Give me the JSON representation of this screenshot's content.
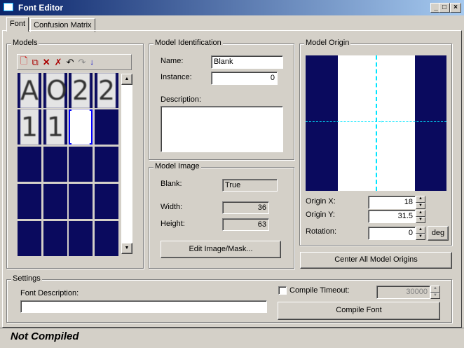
{
  "window": {
    "title": "Font Editor",
    "buttons": [
      "_",
      "□",
      "×"
    ]
  },
  "tabs": [
    {
      "label": "Font",
      "active": true
    },
    {
      "label": "Confusion Matrix",
      "active": false
    }
  ],
  "models": {
    "title": "Models",
    "toolbar": [
      "new-model-icon",
      "copy-model-icon",
      "delete-icon",
      "delete-all-icon",
      "undo-icon",
      "redo-icon",
      "sort-icon"
    ],
    "cells": [
      "A",
      "O",
      "2",
      "2",
      "1",
      "1",
      "",
      "",
      "",
      "",
      "",
      "",
      "",
      "",
      "",
      "",
      "",
      "",
      "",
      ""
    ],
    "selected_index": 6,
    "filled_count": 7
  },
  "identification": {
    "title": "Model Identification",
    "name_label": "Name:",
    "name": "Blank",
    "instance_label": "Instance:",
    "instance": "0",
    "description_label": "Description:",
    "description": ""
  },
  "image": {
    "title": "Model Image",
    "blank_label": "Blank:",
    "blank": "True",
    "width_label": "Width:",
    "width": "36",
    "height_label": "Height:",
    "height": "63",
    "edit_button": "Edit Image/Mask..."
  },
  "origin": {
    "title": "Model Origin",
    "x_label": "Origin X:",
    "x": "18",
    "y_label": "Origin Y:",
    "y": "31.5",
    "rotation_label": "Rotation:",
    "rotation": "0",
    "unit_button": "deg",
    "center_button": "Center All Model Origins"
  },
  "settings": {
    "title": "Settings",
    "font_description_label": "Font Description:",
    "font_description": "",
    "compile_timeout_label": "Compile Timeout:",
    "compile_timeout_checked": false,
    "compile_timeout": "30000",
    "compile_button": "Compile Font"
  },
  "status": "Not Compiled",
  "colors": {
    "navy": "#0a0a5e",
    "cyan": "#00e5ff",
    "selection": "#0000ff"
  }
}
